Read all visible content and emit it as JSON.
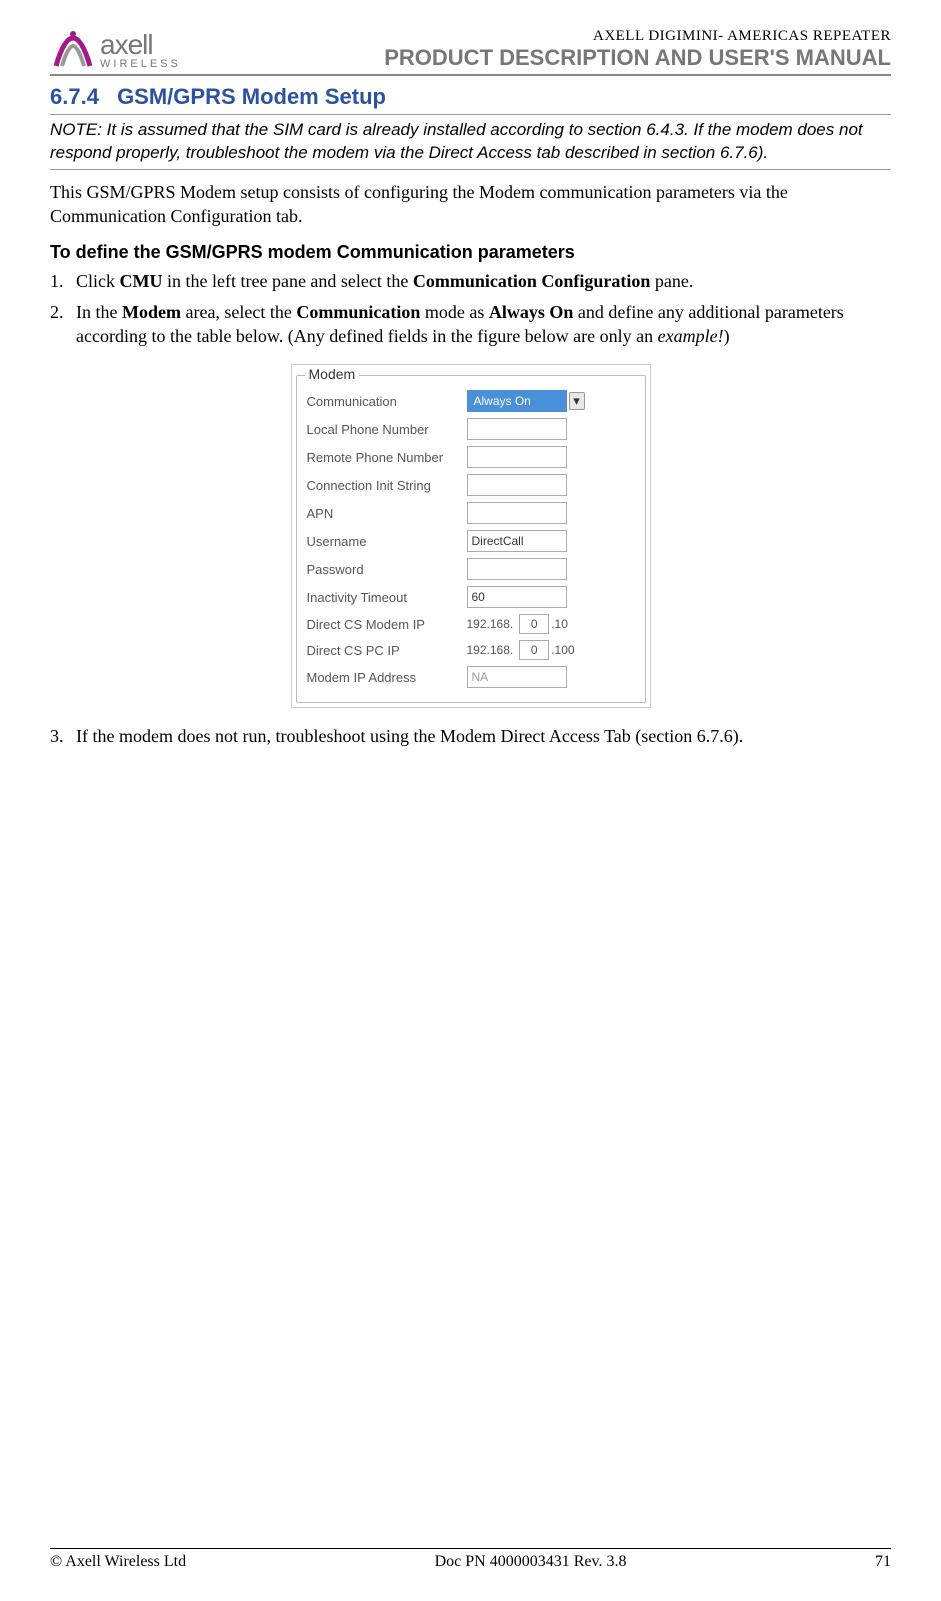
{
  "header": {
    "company": "axell",
    "company_sub": "WIRELESS",
    "doc_small": "AXELL DIGIMINI- AMERICAS REPEATER",
    "doc_large": "PRODUCT DESCRIPTION AND USER'S MANUAL"
  },
  "section": {
    "number": "6.7.4",
    "title": "GSM/GPRS Modem Setup"
  },
  "note": "NOTE: It is assumed that the SIM card is already installed according to section 6.4.3. If the modem does not respond properly, troubleshoot the modem via the Direct Access tab described in section 6.7.6).",
  "intro_para": "This GSM/GPRS Modem setup consists of configuring the Modem communication parameters via the Communication Configuration tab.",
  "subheading": "To define the GSM/GPRS modem Communication parameters",
  "steps": {
    "s1": {
      "t1": "Click ",
      "b1": "CMU",
      "t2": " in the left tree pane and select the ",
      "b2": "Communication Configuration",
      "t3": " pane."
    },
    "s2": {
      "t1": "In the ",
      "b1": "Modem",
      "t2": " area, select the ",
      "b2": "Communication",
      "t3": " mode as ",
      "b3": "Always On",
      "t4": " and define any additional parameters according to the table below. (Any defined fields in the figure below are only an ",
      "i1": "example!",
      "t5": ")"
    },
    "s3": "If the modem does not run, troubleshoot using the Modem Direct Access Tab (section 6.7.6)."
  },
  "modem": {
    "legend": "Modem",
    "rows": {
      "communication": {
        "label": "Communication",
        "value": "Always On"
      },
      "local_phone": {
        "label": "Local Phone Number",
        "value": ""
      },
      "remote_phone": {
        "label": "Remote Phone Number",
        "value": ""
      },
      "conn_init": {
        "label": "Connection Init String",
        "value": ""
      },
      "apn": {
        "label": "APN",
        "value": ""
      },
      "username": {
        "label": "Username",
        "value": "DirectCall"
      },
      "password": {
        "label": "Password",
        "value": ""
      },
      "inactivity": {
        "label": "Inactivity Timeout",
        "value": "60"
      },
      "cs_modem_ip": {
        "label": "Direct CS Modem IP",
        "prefix": "192.168.",
        "octet": "0",
        "suffix": ".10"
      },
      "cs_pc_ip": {
        "label": "Direct CS PC IP",
        "prefix": "192.168.",
        "octet": "0",
        "suffix": ".100"
      },
      "modem_ip": {
        "label": "Modem IP Address",
        "value": "NA"
      }
    }
  },
  "footer": {
    "left": "© Axell Wireless Ltd",
    "center": "Doc PN 4000003431 Rev. 3.8",
    "right": "71"
  }
}
